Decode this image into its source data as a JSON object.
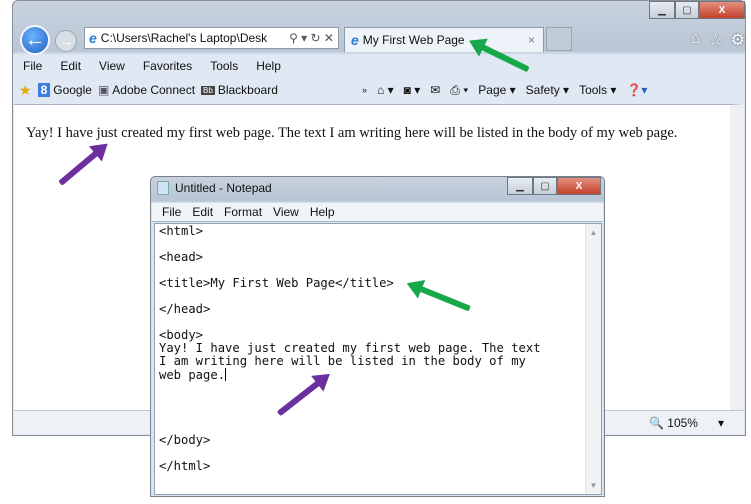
{
  "browser": {
    "address": "C:\\Users\\Rachel's Laptop\\Desk",
    "tab_title": "My First Web Page",
    "menu": [
      "File",
      "Edit",
      "View",
      "Favorites",
      "Tools",
      "Help"
    ],
    "favorites": [
      "Google",
      "Adobe Connect",
      "Blackboard"
    ],
    "commands": [
      "Page",
      "Safety",
      "Tools"
    ],
    "body_text": "Yay! I have just created my first web page. The text I am writing here will be listed in the body of my web page.",
    "zoom": "105%"
  },
  "notepad": {
    "title": "Untitled - Notepad",
    "menu": [
      "File",
      "Edit",
      "Format",
      "View",
      "Help"
    ],
    "content": "<html>\n\n<head>\n\n<title>My First Web Page</title>\n\n</head>\n\n<body>\nYay! I have just created my first web page. The text\nI am writing here will be listed in the body of my\nweb page.",
    "content_end": "\n\n\n\n\n</body>\n\n</html>"
  },
  "colors": {
    "arrow_green": "#17a84a",
    "arrow_purple": "#6b2f9e"
  }
}
